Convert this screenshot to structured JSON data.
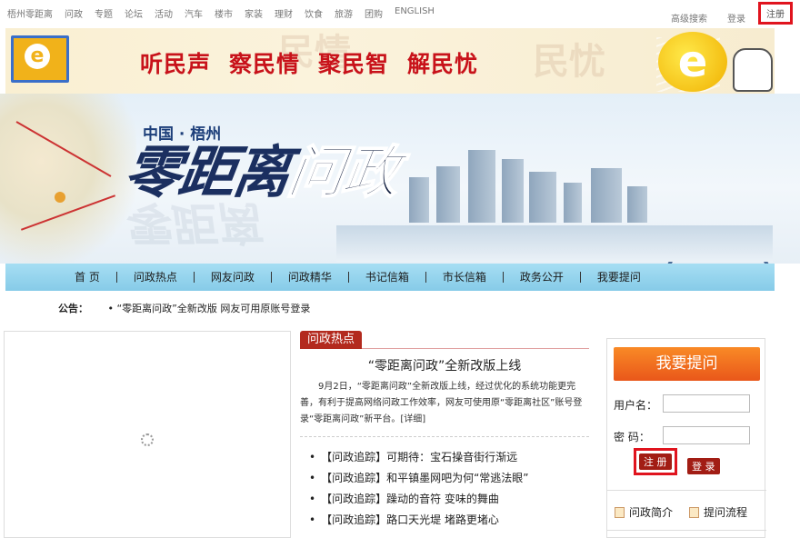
{
  "topnav": {
    "left": [
      "梧州零距离",
      "问政",
      "专题",
      "论坛",
      "活动",
      "汽车",
      "楼市",
      "家装",
      "理财",
      "饮食",
      "旅游",
      "团购",
      "ENGLISH"
    ],
    "advanced_search": "高级搜索",
    "login": "登录",
    "register": "注册"
  },
  "banner": {
    "slogans": [
      "听民声",
      "察民情",
      "聚民智",
      "解民忧"
    ],
    "ghost": [
      "民情",
      "民忧"
    ],
    "e_letter": "e"
  },
  "header": {
    "subtitle": "中国 · 梧州",
    "title_a": "零距离",
    "title_b": "问政"
  },
  "menu": [
    "首  页",
    "问政热点",
    "网友问政",
    "问政精华",
    "书记信箱",
    "市长信箱",
    "政务公开",
    "我要提问"
  ],
  "notice": {
    "label": "公告：",
    "text": "• “零距离问政”全新改版  网友可用原账号登录"
  },
  "hot": {
    "tag": "问政热点",
    "headline": "“零距离问政”全新改版上线",
    "summary": "9月2日，“零距离问政”全新改版上线，经过优化的系统功能更完善，有利于提高网络问政工作效率，网友可使用原“零距离社区”账号登录“零距离问政”新平台。",
    "more": "[详细]",
    "news": [
      "【问政追踪】可期待：宝石操音街行渐远",
      "【问政追踪】和平镇墨网吧为何“常逃法眼”",
      "【问政追踪】躁动的音符 变味的舞曲",
      "【问政追踪】路口天光堤 堵路更堵心"
    ]
  },
  "login": {
    "ask_button": "我要提问",
    "username_label": "用户名：",
    "password_label": "密    码：",
    "register_button": "注 册",
    "login_button": "登 录",
    "intro_link": "问政简介",
    "process_link": "提问流程"
  }
}
